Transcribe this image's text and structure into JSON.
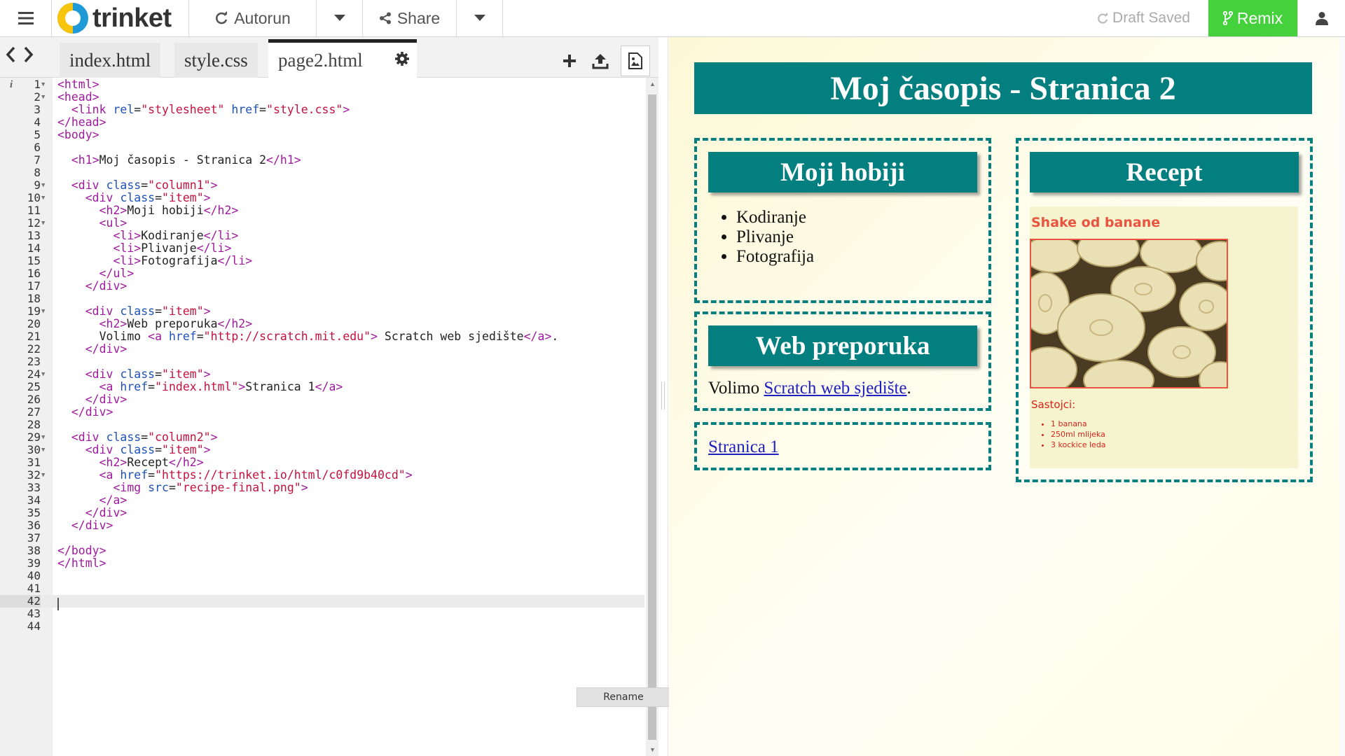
{
  "topbar": {
    "logo_text": "trinket",
    "autorun_label": "Autorun",
    "share_label": "Share",
    "draft_status": "Draft Saved",
    "remix_label": "Remix"
  },
  "tabs": [
    {
      "label": "index.html"
    },
    {
      "label": "style.css"
    },
    {
      "label": "page2.html"
    }
  ],
  "code_lines": [
    "<html>",
    "<head>",
    "  <link rel=\"stylesheet\" href=\"style.css\">",
    "</head>",
    "<body>",
    "",
    "  <h1>Moj časopis - Stranica 2</h1>",
    "",
    "  <div class=\"column1\">",
    "    <div class=\"item\">",
    "      <h2>Moji hobiji</h2>",
    "      <ul>",
    "        <li>Kodiranje</li>",
    "        <li>Plivanje</li>",
    "        <li>Fotografija</li>",
    "      </ul>",
    "    </div>",
    "",
    "    <div class=\"item\">",
    "      <h2>Web preporuka</h2>",
    "      Volimo <a href=\"http://scratch.mit.edu\"> Scratch web sjedište</a>.",
    "    </div>",
    "",
    "    <div class=\"item\">",
    "      <a href=\"index.html\">Stranica 1</a>",
    "    </div>",
    "  </div>",
    "",
    "  <div class=\"column2\">",
    "    <div class=\"item\">",
    "      <h2>Recept</h2>",
    "      <a href=\"https://trinket.io/html/c0fd9b40cd\">",
    "        <img src=\"recipe-final.png\">",
    "      </a>",
    "    </div>",
    "  </div>",
    "",
    "</body>",
    "</html>",
    "",
    "",
    "",
    "",
    ""
  ],
  "line_numbers": [
    "1",
    "2",
    "3",
    "4",
    "5",
    "6",
    "7",
    "8",
    "9",
    "10",
    "11",
    "12",
    "13",
    "14",
    "15",
    "16",
    "17",
    "18",
    "19",
    "20",
    "21",
    "22",
    "23",
    "24",
    "25",
    "26",
    "27",
    "28",
    "29",
    "30",
    "31",
    "32",
    "33",
    "34",
    "35",
    "36",
    "37",
    "38",
    "39",
    "40",
    "41",
    "42",
    "43",
    "44"
  ],
  "fold_lines": [
    1,
    2,
    9,
    10,
    12,
    19,
    24,
    29,
    30,
    32
  ],
  "current_line": 42,
  "rename_label": "Rename",
  "preview": {
    "h1": "Moj časopis - Stranica 2",
    "hobbies": {
      "title": "Moji hobiji",
      "items": [
        "Kodiranje",
        "Plivanje",
        "Fotografija"
      ]
    },
    "web": {
      "title": "Web preporuka",
      "text_before": "Volimo ",
      "link_text": "Scratch web sjedište",
      "text_after": "."
    },
    "page_link": "Stranica 1",
    "recipe": {
      "title": "Recept",
      "card_title": "Shake od banane",
      "ingredients_label": "Sastojci:",
      "ingredients": [
        "1 banana",
        "250ml mlijeka",
        "3 kockice leda"
      ]
    }
  },
  "colors": {
    "teal": "#047f7f",
    "remix": "#45d13c",
    "tag": "#a0199e",
    "attr": "#1e51b8",
    "string": "#c4123f",
    "recipe_red": "#e8543f"
  }
}
